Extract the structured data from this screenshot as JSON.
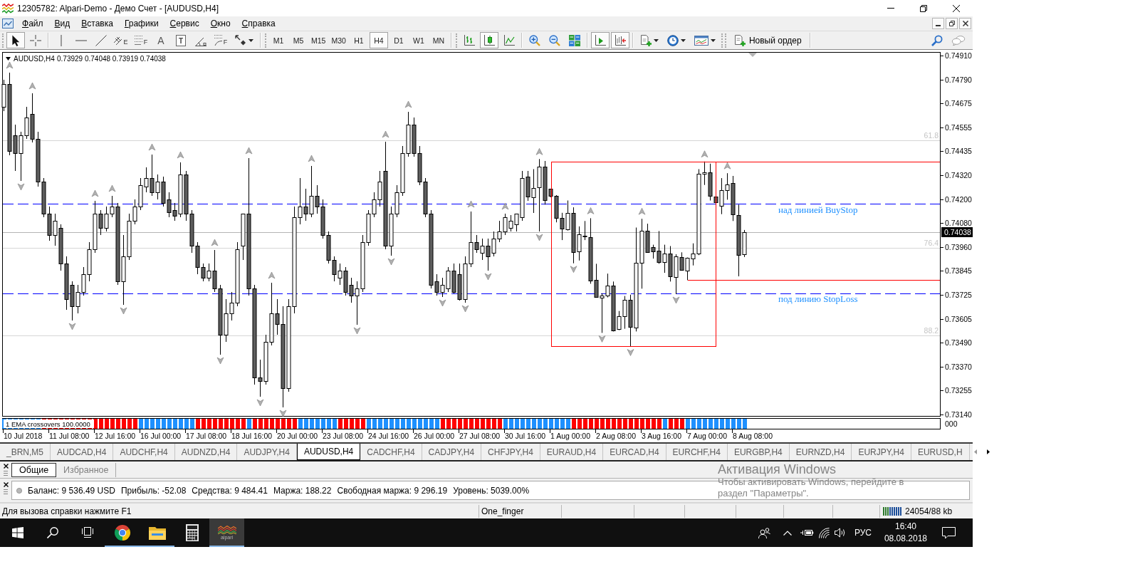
{
  "window": {
    "title": "12305782: Alpari-Demo - Демо Счет - [AUDUSD,H4]"
  },
  "menu": {
    "items": [
      "Файл",
      "Вид",
      "Вставка",
      "Графики",
      "Сервис",
      "Окно",
      "Справка"
    ]
  },
  "toolbar": {
    "tools": [
      {
        "kind": "cursor",
        "selected": true
      },
      {
        "kind": "crosshair",
        "selected": false
      },
      {
        "kind": "vertical-line",
        "selected": false
      },
      {
        "kind": "horizontal-line",
        "selected": false
      },
      {
        "kind": "trendline",
        "selected": false
      },
      {
        "kind": "channel",
        "glyph": "E",
        "selected": false
      },
      {
        "kind": "fibo",
        "glyph": "F",
        "selected": false
      },
      {
        "kind": "text",
        "glyph": "A",
        "selected": false
      },
      {
        "kind": "label",
        "glyph": "T",
        "selected": false
      },
      {
        "kind": "angle",
        "selected": false
      },
      {
        "kind": "fibo-fan",
        "glyph": "F",
        "selected": false
      },
      {
        "kind": "arrows",
        "selected": false
      }
    ],
    "timeframes": [
      {
        "label": "M1",
        "selected": false
      },
      {
        "label": "M5",
        "selected": false
      },
      {
        "label": "M15",
        "selected": false
      },
      {
        "label": "M30",
        "selected": false
      },
      {
        "label": "H1",
        "selected": false
      },
      {
        "label": "H4",
        "selected": true
      },
      {
        "label": "D1",
        "selected": false
      },
      {
        "label": "W1",
        "selected": false
      },
      {
        "label": "MN",
        "selected": false
      }
    ],
    "chart_types": [
      {
        "kind": "bars",
        "selected": false
      },
      {
        "kind": "candles",
        "selected": true
      },
      {
        "kind": "line",
        "selected": false
      }
    ],
    "autoscroll": {
      "on": true
    },
    "chart_shift": {
      "on": true
    },
    "new_order": "Новый ордер"
  },
  "chart": {
    "symbol": "AUDUSD,H4",
    "ohlc": "0.73929 0.74048 0.73919 0.74038",
    "price_labels": [
      "0.74910",
      "0.74790",
      "0.74675",
      "0.74555",
      "0.74435",
      "0.74320",
      "0.74200",
      "0.74080",
      "0.73960",
      "0.73845",
      "0.73725",
      "0.73605",
      "0.73490",
      "0.73370",
      "0.73255",
      "0.73140"
    ],
    "current_price": "0.74038",
    "fibo_levels": [
      "61.8",
      "76.4",
      "88.2"
    ],
    "text_labels": [
      "над линией BuyStop",
      "под линию StopLoss"
    ],
    "time_labels": [
      "10 Jul 2018",
      "11 Jul 08:00",
      "12 Jul 16:00",
      "16 Jul 00:00",
      "17 Jul 08:00",
      "18 Jul 16:00",
      "20 Jul 00:00",
      "23 Jul 08:00",
      "24 Jul 16:00",
      "26 Jul 00:00",
      "27 Jul 08:00",
      "30 Jul 16:00",
      "1 Aug 00:00",
      "2 Aug 08:00",
      "3 Aug 16:00",
      "7 Aug 00:00",
      "8 Aug 08:00"
    ],
    "indicator": {
      "label": "1 EMA crossovers 100.0000",
      "axis_label": "000"
    }
  },
  "symbol_tabs": [
    {
      "label": "_BRN,M5",
      "selected": false
    },
    {
      "label": "AUDCAD,H4",
      "selected": false
    },
    {
      "label": "AUDCHF,H4",
      "selected": false
    },
    {
      "label": "AUDNZD,H4",
      "selected": false
    },
    {
      "label": "AUDJPY,H4",
      "selected": false
    },
    {
      "label": "AUDUSD,H4",
      "selected": true
    },
    {
      "label": "CADCHF,H4",
      "selected": false
    },
    {
      "label": "CADJPY,H4",
      "selected": false
    },
    {
      "label": "CHFJPY,H4",
      "selected": false
    },
    {
      "label": "EURAUD,H4",
      "selected": false
    },
    {
      "label": "EURCAD,H4",
      "selected": false
    },
    {
      "label": "EURCHF,H4",
      "selected": false
    },
    {
      "label": "EURGBP,H4",
      "selected": false
    },
    {
      "label": "EURNZD,H4",
      "selected": false
    },
    {
      "label": "EURJPY,H4",
      "selected": false
    },
    {
      "label": "EURUSD,H",
      "selected": false
    }
  ],
  "terminal": {
    "tabs": [
      {
        "label": "Общие",
        "selected": true
      },
      {
        "label": "Избранное",
        "selected": false
      }
    ],
    "account": [
      "Баланс: 9 536.49 USD",
      "Прибыль: -52.08",
      "Средства: 9 484.41",
      "Маржа: 188.22",
      "Свободная маржа: 9 296.19",
      "Уровень: 5039.00%"
    ]
  },
  "status_bar": {
    "help": "Для вызова справки нажмите F1",
    "profile": "One_finger",
    "traffic": "24054/88 kb"
  },
  "activation_notice": {
    "title": "Активация Windows",
    "text": "Чтобы активировать Windows, перейдите в раздел \"Параметры\"."
  },
  "taskbar": {
    "apps": [
      {
        "kind": "browser",
        "running": true,
        "active": false
      },
      {
        "kind": "folder",
        "running": true,
        "active": false
      },
      {
        "kind": "calculator",
        "running": false,
        "active": false
      },
      {
        "kind": "terminal",
        "label": "alpari",
        "running": true,
        "active": true
      }
    ],
    "language": "РУС",
    "time": "16:40",
    "date": "08.08.2018"
  }
}
